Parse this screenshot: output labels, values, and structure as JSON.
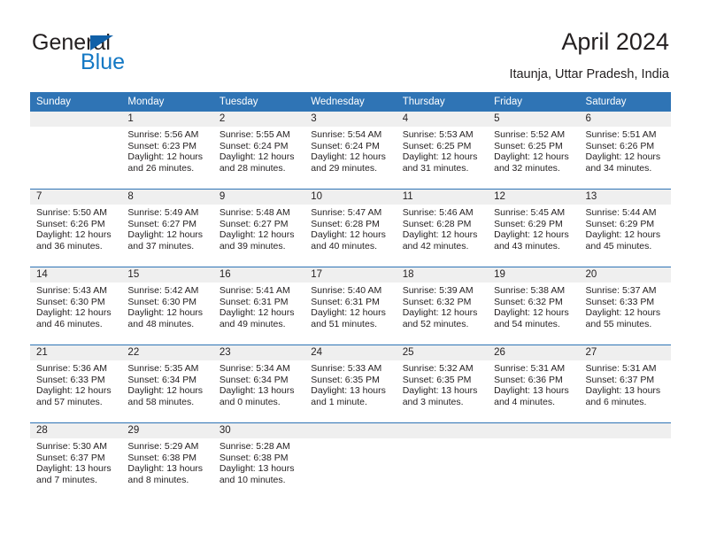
{
  "brand": {
    "word1": "General",
    "word2": "Blue",
    "triangle_color": "#1060a8",
    "blue_text_color": "#1378c4"
  },
  "header": {
    "title": "April 2024",
    "subtitle": "Itaunja, Uttar Pradesh, India"
  },
  "theme": {
    "header_blue": "#2f74b5",
    "daynum_band": "#efefef",
    "text": "#231f20"
  },
  "columns": [
    "Sunday",
    "Monday",
    "Tuesday",
    "Wednesday",
    "Thursday",
    "Friday",
    "Saturday"
  ],
  "labels": {
    "sunrise_prefix": "Sunrise:",
    "sunset_prefix": "Sunset:",
    "daylight_prefix": "Daylight:"
  },
  "weeks": [
    [
      {
        "day": ""
      },
      {
        "day": "1",
        "sunrise": "Sunrise: 5:56 AM",
        "sunset": "Sunset: 6:23 PM",
        "daylight_line1": "Daylight: 12 hours",
        "daylight_line2": "and 26 minutes."
      },
      {
        "day": "2",
        "sunrise": "Sunrise: 5:55 AM",
        "sunset": "Sunset: 6:24 PM",
        "daylight_line1": "Daylight: 12 hours",
        "daylight_line2": "and 28 minutes."
      },
      {
        "day": "3",
        "sunrise": "Sunrise: 5:54 AM",
        "sunset": "Sunset: 6:24 PM",
        "daylight_line1": "Daylight: 12 hours",
        "daylight_line2": "and 29 minutes."
      },
      {
        "day": "4",
        "sunrise": "Sunrise: 5:53 AM",
        "sunset": "Sunset: 6:25 PM",
        "daylight_line1": "Daylight: 12 hours",
        "daylight_line2": "and 31 minutes."
      },
      {
        "day": "5",
        "sunrise": "Sunrise: 5:52 AM",
        "sunset": "Sunset: 6:25 PM",
        "daylight_line1": "Daylight: 12 hours",
        "daylight_line2": "and 32 minutes."
      },
      {
        "day": "6",
        "sunrise": "Sunrise: 5:51 AM",
        "sunset": "Sunset: 6:26 PM",
        "daylight_line1": "Daylight: 12 hours",
        "daylight_line2": "and 34 minutes."
      }
    ],
    [
      {
        "day": "7",
        "sunrise": "Sunrise: 5:50 AM",
        "sunset": "Sunset: 6:26 PM",
        "daylight_line1": "Daylight: 12 hours",
        "daylight_line2": "and 36 minutes."
      },
      {
        "day": "8",
        "sunrise": "Sunrise: 5:49 AM",
        "sunset": "Sunset: 6:27 PM",
        "daylight_line1": "Daylight: 12 hours",
        "daylight_line2": "and 37 minutes."
      },
      {
        "day": "9",
        "sunrise": "Sunrise: 5:48 AM",
        "sunset": "Sunset: 6:27 PM",
        "daylight_line1": "Daylight: 12 hours",
        "daylight_line2": "and 39 minutes."
      },
      {
        "day": "10",
        "sunrise": "Sunrise: 5:47 AM",
        "sunset": "Sunset: 6:28 PM",
        "daylight_line1": "Daylight: 12 hours",
        "daylight_line2": "and 40 minutes."
      },
      {
        "day": "11",
        "sunrise": "Sunrise: 5:46 AM",
        "sunset": "Sunset: 6:28 PM",
        "daylight_line1": "Daylight: 12 hours",
        "daylight_line2": "and 42 minutes."
      },
      {
        "day": "12",
        "sunrise": "Sunrise: 5:45 AM",
        "sunset": "Sunset: 6:29 PM",
        "daylight_line1": "Daylight: 12 hours",
        "daylight_line2": "and 43 minutes."
      },
      {
        "day": "13",
        "sunrise": "Sunrise: 5:44 AM",
        "sunset": "Sunset: 6:29 PM",
        "daylight_line1": "Daylight: 12 hours",
        "daylight_line2": "and 45 minutes."
      }
    ],
    [
      {
        "day": "14",
        "sunrise": "Sunrise: 5:43 AM",
        "sunset": "Sunset: 6:30 PM",
        "daylight_line1": "Daylight: 12 hours",
        "daylight_line2": "and 46 minutes."
      },
      {
        "day": "15",
        "sunrise": "Sunrise: 5:42 AM",
        "sunset": "Sunset: 6:30 PM",
        "daylight_line1": "Daylight: 12 hours",
        "daylight_line2": "and 48 minutes."
      },
      {
        "day": "16",
        "sunrise": "Sunrise: 5:41 AM",
        "sunset": "Sunset: 6:31 PM",
        "daylight_line1": "Daylight: 12 hours",
        "daylight_line2": "and 49 minutes."
      },
      {
        "day": "17",
        "sunrise": "Sunrise: 5:40 AM",
        "sunset": "Sunset: 6:31 PM",
        "daylight_line1": "Daylight: 12 hours",
        "daylight_line2": "and 51 minutes."
      },
      {
        "day": "18",
        "sunrise": "Sunrise: 5:39 AM",
        "sunset": "Sunset: 6:32 PM",
        "daylight_line1": "Daylight: 12 hours",
        "daylight_line2": "and 52 minutes."
      },
      {
        "day": "19",
        "sunrise": "Sunrise: 5:38 AM",
        "sunset": "Sunset: 6:32 PM",
        "daylight_line1": "Daylight: 12 hours",
        "daylight_line2": "and 54 minutes."
      },
      {
        "day": "20",
        "sunrise": "Sunrise: 5:37 AM",
        "sunset": "Sunset: 6:33 PM",
        "daylight_line1": "Daylight: 12 hours",
        "daylight_line2": "and 55 minutes."
      }
    ],
    [
      {
        "day": "21",
        "sunrise": "Sunrise: 5:36 AM",
        "sunset": "Sunset: 6:33 PM",
        "daylight_line1": "Daylight: 12 hours",
        "daylight_line2": "and 57 minutes."
      },
      {
        "day": "22",
        "sunrise": "Sunrise: 5:35 AM",
        "sunset": "Sunset: 6:34 PM",
        "daylight_line1": "Daylight: 12 hours",
        "daylight_line2": "and 58 minutes."
      },
      {
        "day": "23",
        "sunrise": "Sunrise: 5:34 AM",
        "sunset": "Sunset: 6:34 PM",
        "daylight_line1": "Daylight: 13 hours",
        "daylight_line2": "and 0 minutes."
      },
      {
        "day": "24",
        "sunrise": "Sunrise: 5:33 AM",
        "sunset": "Sunset: 6:35 PM",
        "daylight_line1": "Daylight: 13 hours",
        "daylight_line2": "and 1 minute."
      },
      {
        "day": "25",
        "sunrise": "Sunrise: 5:32 AM",
        "sunset": "Sunset: 6:35 PM",
        "daylight_line1": "Daylight: 13 hours",
        "daylight_line2": "and 3 minutes."
      },
      {
        "day": "26",
        "sunrise": "Sunrise: 5:31 AM",
        "sunset": "Sunset: 6:36 PM",
        "daylight_line1": "Daylight: 13 hours",
        "daylight_line2": "and 4 minutes."
      },
      {
        "day": "27",
        "sunrise": "Sunrise: 5:31 AM",
        "sunset": "Sunset: 6:37 PM",
        "daylight_line1": "Daylight: 13 hours",
        "daylight_line2": "and 6 minutes."
      }
    ],
    [
      {
        "day": "28",
        "sunrise": "Sunrise: 5:30 AM",
        "sunset": "Sunset: 6:37 PM",
        "daylight_line1": "Daylight: 13 hours",
        "daylight_line2": "and 7 minutes."
      },
      {
        "day": "29",
        "sunrise": "Sunrise: 5:29 AM",
        "sunset": "Sunset: 6:38 PM",
        "daylight_line1": "Daylight: 13 hours",
        "daylight_line2": "and 8 minutes."
      },
      {
        "day": "30",
        "sunrise": "Sunrise: 5:28 AM",
        "sunset": "Sunset: 6:38 PM",
        "daylight_line1": "Daylight: 13 hours",
        "daylight_line2": "and 10 minutes."
      },
      {
        "day": ""
      },
      {
        "day": ""
      },
      {
        "day": ""
      },
      {
        "day": ""
      }
    ]
  ]
}
